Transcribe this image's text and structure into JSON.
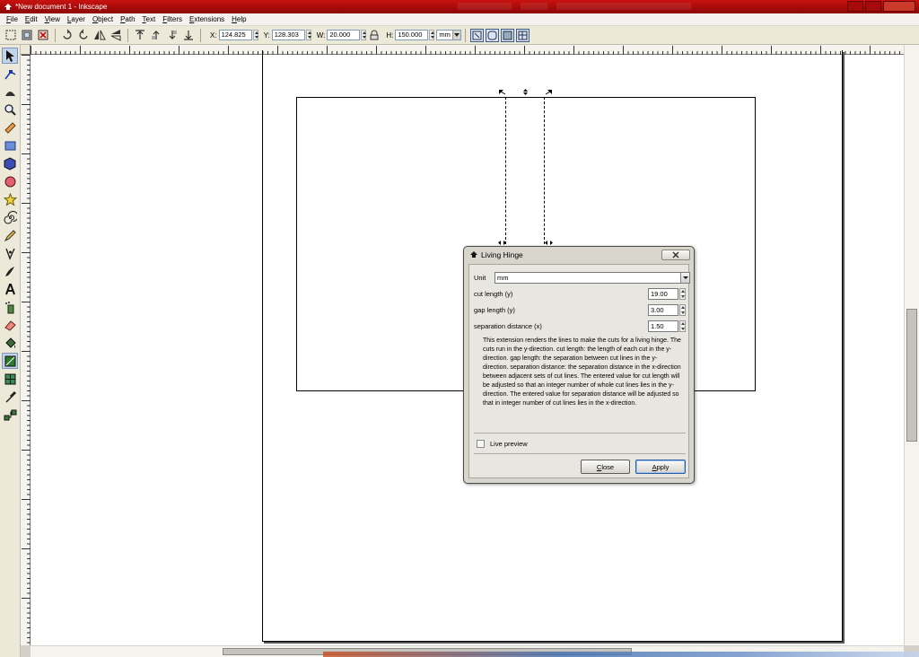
{
  "window": {
    "title": "*New document 1 - Inkscape"
  },
  "menu": [
    "File",
    "Edit",
    "View",
    "Layer",
    "Object",
    "Path",
    "Text",
    "Filters",
    "Extensions",
    "Help"
  ],
  "controls": {
    "x_label": "X:",
    "x_value": "124.825",
    "y_label": "Y:",
    "y_value": "128.303",
    "w_label": "W:",
    "w_value": "20.000",
    "h_label": "H:",
    "h_value": "150.000",
    "unit": "mm"
  },
  "tools": [
    "selector-tool",
    "node-tool",
    "tweak-tool",
    "zoom-tool",
    "measure-tool",
    "rectangle-tool",
    "3d-box-tool",
    "ellipse-tool",
    "star-tool",
    "spiral-tool",
    "pencil-tool",
    "pen-tool",
    "calligraphy-tool",
    "text-tool",
    "spray-tool",
    "eraser-tool",
    "paint-bucket-tool",
    "gradient-tool",
    "mesh-tool",
    "dropper-tool",
    "connector-tool"
  ],
  "dialog": {
    "title": "Living Hinge",
    "unit_label": "Unit",
    "unit_value": "mm",
    "cut_length_label": "cut length (y)",
    "cut_length_value": "19.00",
    "gap_length_label": "gap length (y)",
    "gap_length_value": "3.00",
    "separation_label": "separation distance (x)",
    "separation_value": "1.50",
    "description": "This extension renders the lines to make the cuts for a living hinge. The cuts run in the y-direction. cut length: the length of each cut in the y-direction. gap length: the separation between cut lines in the y-direction. separation distance: the separation distance in the x-direction between adjacent sets of cut lines. The entered value for cut length will be adjusted so that an integer number of whole cut lines lies in the y-direction. The entered value for separation distance will be adjusted so that in integer number of cut lines lies in the x-direction.",
    "live_preview_label": "Live preview",
    "live_preview_checked": false,
    "close_label": "Close",
    "apply_label": "Apply"
  }
}
